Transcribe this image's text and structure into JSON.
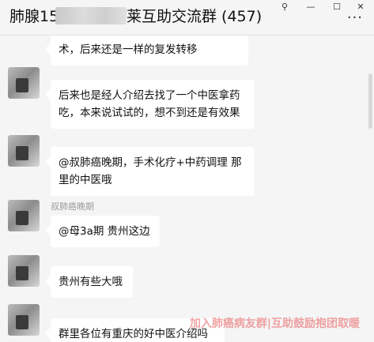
{
  "header": {
    "title_prefix": "肺腺15",
    "title_suffix": "莱互助交流群 (457)",
    "more_label": "···",
    "window_controls": {
      "pin": "⚲",
      "minimize": "—",
      "maximize": "☐",
      "close": "✕"
    }
  },
  "messages": [
    {
      "text": "术，后来还是一样的复发转移"
    },
    {
      "lines": [
        "后来也是经人介绍去找了一个中医拿药",
        "吃，本来说试试的，想不到还是有效果"
      ]
    },
    {
      "lines": [
        "@叔肺癌晚期，手术化疗+中药调理 那",
        "里的中医哦"
      ]
    },
    {
      "nickname": "叔肺癌晚期",
      "text": "@母3a期 贵州这边"
    },
    {
      "text": "贵州有些大哦"
    },
    {
      "text": "群里各位有重庆的好中医介绍吗"
    }
  ],
  "watermark": "加入肺癌病友群|互助鼓励抱团取暖",
  "colors": {
    "background": "#f5f5f5",
    "bubble": "#ffffff",
    "watermark": "#e65a5a"
  }
}
